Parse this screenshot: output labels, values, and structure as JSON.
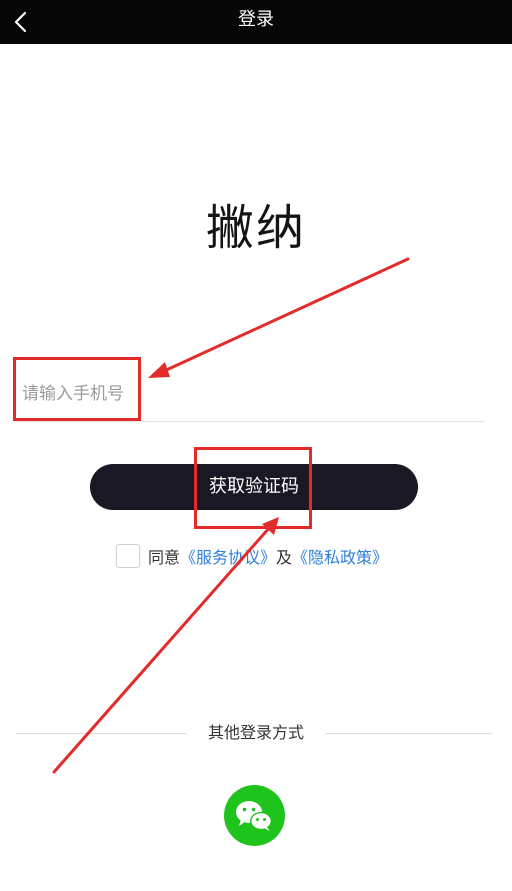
{
  "nav": {
    "title": "登录",
    "back_icon": "chevron-left-icon"
  },
  "app_title": "撇纳",
  "phone_input": {
    "placeholder": "请输入手机号",
    "value": ""
  },
  "get_code_button": "获取验证码",
  "agreement": {
    "prefix": "同意",
    "service_link": "《服务协议》",
    "and": "及",
    "privacy_link": "《隐私政策》"
  },
  "other_login": {
    "label": "其他登录方式",
    "wechat_icon": "wechat-icon"
  },
  "colors": {
    "nav_background": "#060606",
    "button_background": "#1a1923",
    "link": "#2f7ed8",
    "wechat_green": "#1ec41b",
    "annotation_red": "#e32b2b"
  }
}
